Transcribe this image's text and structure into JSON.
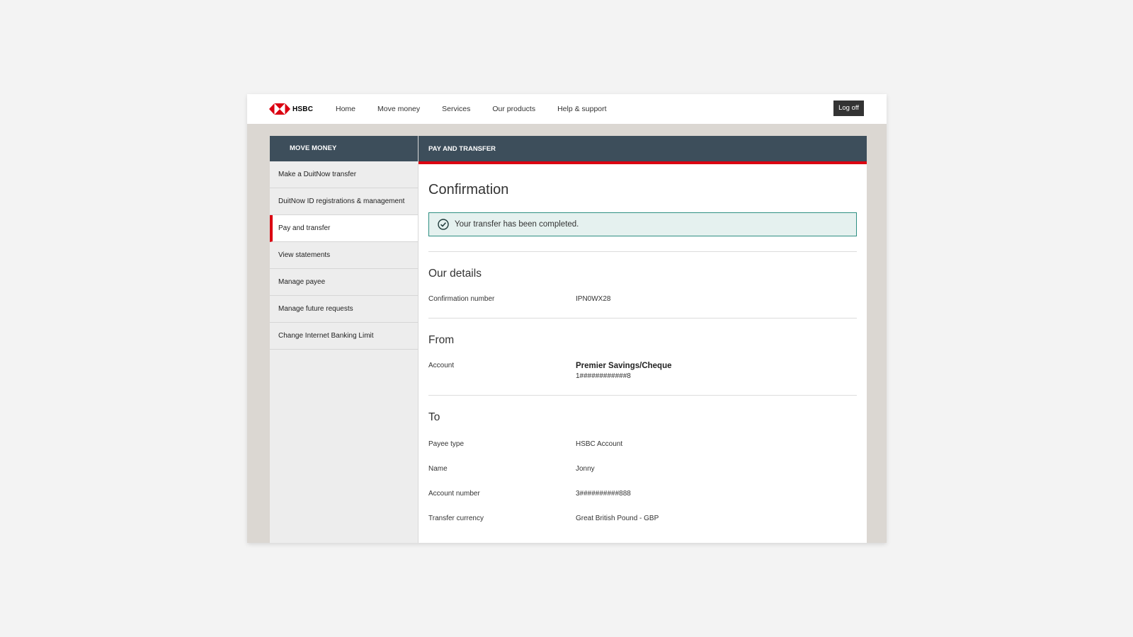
{
  "brand": {
    "name": "HSBC",
    "color": "#db0011"
  },
  "nav": {
    "items": [
      "Home",
      "Move money",
      "Services",
      "Our products",
      "Help & support"
    ],
    "logoff_label": "Log off"
  },
  "sidebar": {
    "title": "MOVE MONEY",
    "items": [
      {
        "label": "Make a DuitNow transfer"
      },
      {
        "label": "DuitNow ID registrations & management"
      },
      {
        "label": "Pay and transfer",
        "active": true
      },
      {
        "label": "View statements"
      },
      {
        "label": "Manage payee"
      },
      {
        "label": "Manage future requests"
      },
      {
        "label": "Change Internet Banking Limit"
      }
    ]
  },
  "main": {
    "header": "PAY AND TRANSFER",
    "title": "Confirmation",
    "alert": {
      "icon": "check-circle-icon",
      "text": "Your transfer has been completed.",
      "color": "#2e8f82"
    },
    "our_details": {
      "title": "Our details",
      "confirmation_label": "Confirmation number",
      "confirmation_value": "IPN0WX28"
    },
    "from": {
      "title": "From",
      "account_label": "Account",
      "account_name": "Premier Savings/Cheque",
      "account_number": "1############8"
    },
    "to": {
      "title": "To",
      "rows": [
        {
          "label": "Payee type",
          "value": "HSBC Account"
        },
        {
          "label": "Name",
          "value": "Jonny"
        },
        {
          "label": "Account number",
          "value": "3##########888"
        },
        {
          "label": "Transfer currency",
          "value": "Great British Pound - GBP"
        }
      ]
    }
  },
  "colors": {
    "header_bg": "#3d4e5b",
    "accent": "#db0011",
    "frame_bg": "#dbd7d2"
  }
}
